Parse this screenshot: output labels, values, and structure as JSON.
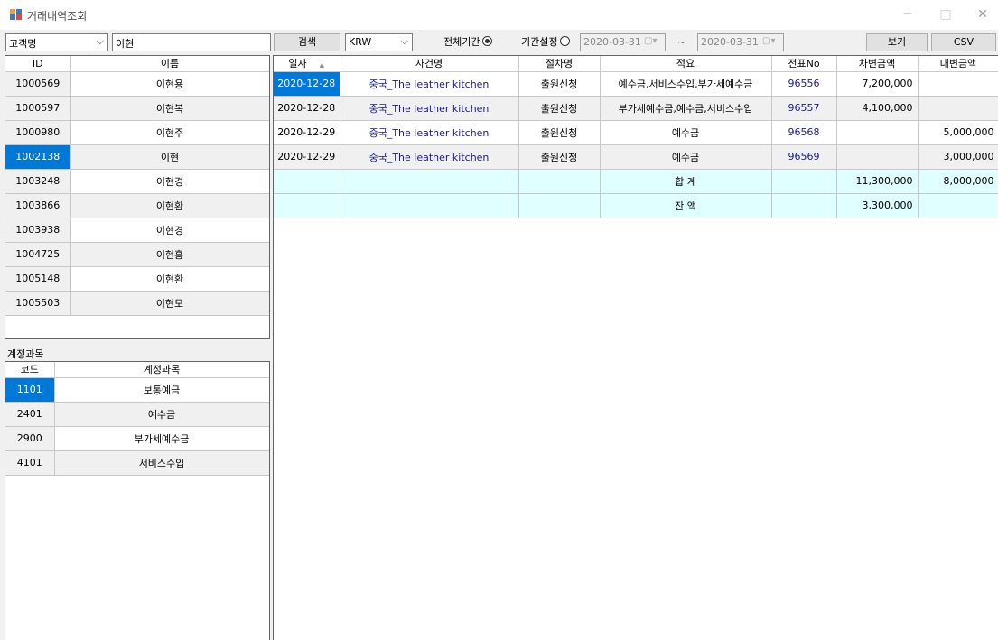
{
  "window": {
    "title": "거래내역조회",
    "minimize": "─",
    "maximize": "□",
    "close": "✕"
  },
  "toolbar": {
    "search_type": "고객명",
    "search_value": "이현",
    "search_button": "검색",
    "currency": "KRW",
    "all_period_label": "전체기간",
    "period_setting_label": "기간설정",
    "date_from": "2020-03-31",
    "date_to": "2020-03-31",
    "tilde": "~",
    "view_button": "보기",
    "csv_button": "CSV"
  },
  "customers": {
    "headers": [
      "ID",
      "이름"
    ],
    "rows": [
      {
        "id": "1000569",
        "name": "이현용"
      },
      {
        "id": "1000597",
        "name": "이현복"
      },
      {
        "id": "1000980",
        "name": "이현주"
      },
      {
        "id": "1002138",
        "name": "이현"
      },
      {
        "id": "1003248",
        "name": "이현경"
      },
      {
        "id": "1003866",
        "name": "이현환"
      },
      {
        "id": "1003938",
        "name": "이현경"
      },
      {
        "id": "1004725",
        "name": "이현홍"
      },
      {
        "id": "1005148",
        "name": "이현환"
      },
      {
        "id": "1005503",
        "name": "이현모"
      }
    ],
    "selected_index": 3
  },
  "accounts": {
    "section_label": "계정과목",
    "headers": [
      "코드",
      "계정과목"
    ],
    "rows": [
      {
        "code": "1101",
        "name": "보통예금"
      },
      {
        "code": "2401",
        "name": "예수금"
      },
      {
        "code": "2900",
        "name": "부가세예수금"
      },
      {
        "code": "4101",
        "name": "서비스수입"
      }
    ],
    "selected_index": 0
  },
  "transactions": {
    "headers": [
      "일자",
      "사건명",
      "절차명",
      "적요",
      "전표No",
      "차변금액",
      "대변금액"
    ],
    "sort_indicator": "▲",
    "rows": [
      {
        "date": "2020-12-28",
        "case": "중국_The leather kitchen",
        "proc": "출원신청",
        "memo": "예수금,서비스수입,부가세예수금",
        "no": "96556",
        "debit": "7,200,000",
        "credit": ""
      },
      {
        "date": "2020-12-28",
        "case": "중국_The leather kitchen",
        "proc": "출원신청",
        "memo": "부가세예수금,예수금,서비스수입",
        "no": "96557",
        "debit": "4,100,000",
        "credit": ""
      },
      {
        "date": "2020-12-29",
        "case": "중국_The leather kitchen",
        "proc": "출원신청",
        "memo": "예수금",
        "no": "96568",
        "debit": "",
        "credit": "5,000,000"
      },
      {
        "date": "2020-12-29",
        "case": "중국_The leather kitchen",
        "proc": "출원신청",
        "memo": "예수금",
        "no": "96569",
        "debit": "",
        "credit": "3,000,000"
      }
    ],
    "total": {
      "label": "합   계",
      "debit": "11,300,000",
      "credit": "8,000,000"
    },
    "balance": {
      "label": "잔   액",
      "debit": "3,300,000",
      "credit": ""
    }
  }
}
